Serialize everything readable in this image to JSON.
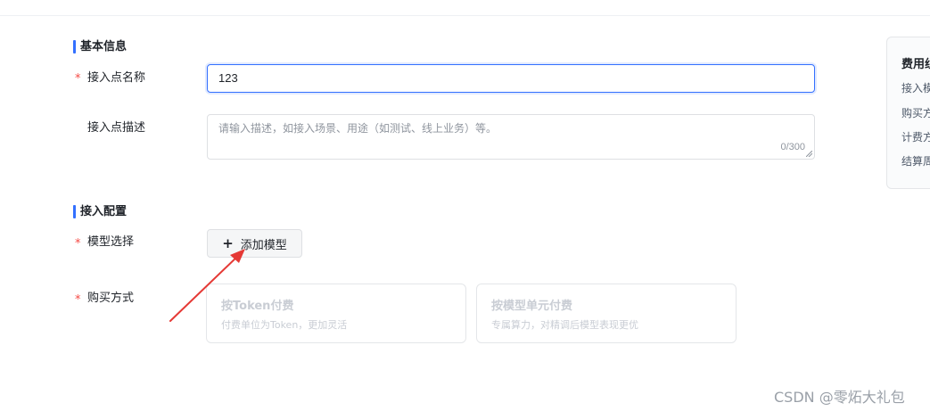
{
  "basic_section": {
    "title": "基本信息"
  },
  "name_field": {
    "required_mark": "*",
    "label": "接入点名称",
    "value": "123"
  },
  "desc_field": {
    "label": "接入点描述",
    "placeholder": "请输入描述，如接入场景、用途（如测试、线上业务）等。",
    "counter": "0/300"
  },
  "config_section": {
    "title": "接入配置"
  },
  "model_field": {
    "required_mark": "*",
    "label": "模型选择",
    "button_icon": "plus-icon",
    "button_label": "添加模型"
  },
  "purchase_field": {
    "required_mark": "*",
    "label": "购买方式",
    "options": [
      {
        "title": "按Token付费",
        "desc": "付费单位为Token，更加灵活"
      },
      {
        "title": "按模型单元付费",
        "desc": "专属算力，对精调后模型表现更优"
      }
    ]
  },
  "side_panel": {
    "title": "费用组",
    "items": [
      "接入模",
      "购买方",
      "计费方",
      "结算周"
    ]
  },
  "annotation": {
    "color": "#e53935"
  },
  "watermark": "CSDN @零炻大礼包"
}
